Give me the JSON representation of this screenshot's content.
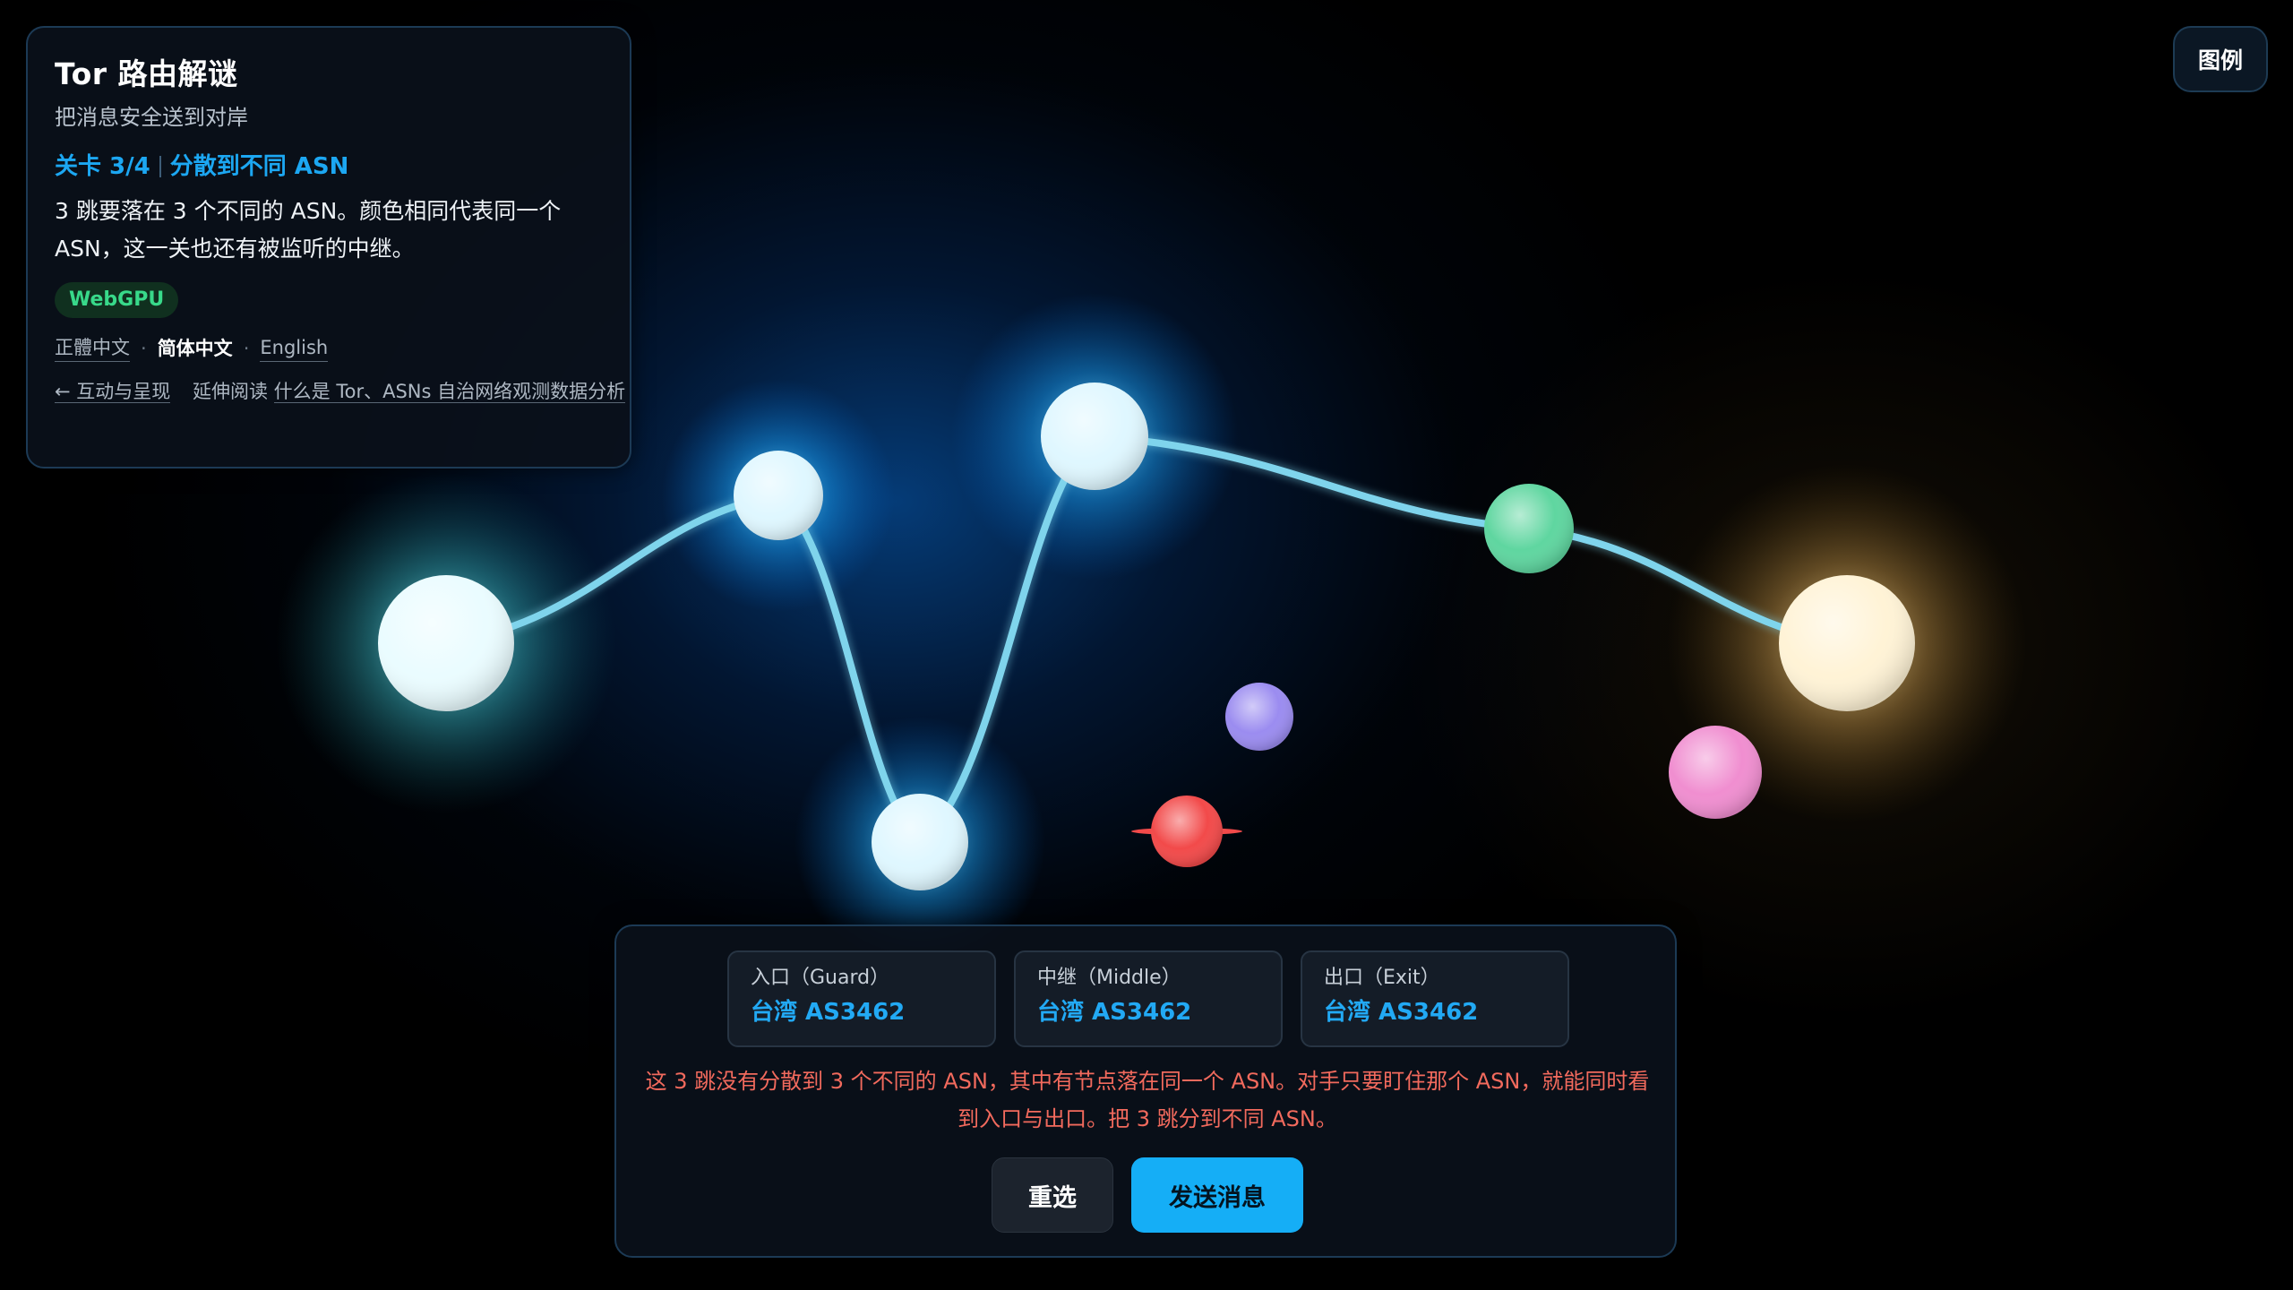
{
  "colors": {
    "accent": "#1ca7f2",
    "warning": "#f26a5d",
    "badge": "#38d98a",
    "path_line": "#7fd4ec",
    "send_button": "#15aef6"
  },
  "info": {
    "title": "Tor 路由解谜",
    "subtitle": "把消息安全送到对岸",
    "level_label": "关卡 3/4",
    "level_name": "分散到不同 ASN",
    "description": "3 跳要落在 3 个不同的 ASN。颜色相同代表同一个 ASN，这一关也还有被监听的中继。",
    "renderer_badge": "WebGPU",
    "languages": [
      "正體中文",
      "简体中文",
      "English"
    ],
    "active_language": "简体中文",
    "back_link": "← 互动与呈现",
    "further_reading_label": "延伸阅读",
    "further_reading_link": "什么是 Tor、ASNs 自治网络观测数据分析"
  },
  "legend": {
    "label": "图例"
  },
  "route": {
    "hops": [
      {
        "role": "入口（Guard）",
        "value": "台湾 AS3462"
      },
      {
        "role": "中继（Middle）",
        "value": "台湾 AS3462"
      },
      {
        "role": "出口（Exit）",
        "value": "台湾 AS3462"
      }
    ],
    "warning": "这 3 跳没有分散到 3 个不同的 ASN，其中有节点落在同一个 ASN。对手只要盯住那个 ASN，就能同时看到入口与出口。把 3 跳分到不同 ASN。",
    "reselect_label": "重选",
    "send_label": "发送消息"
  },
  "nodes": [
    {
      "id": "origin",
      "kind": "endpoint",
      "color": "#eafcff",
      "selected": true
    },
    {
      "id": "relay-a",
      "kind": "relay",
      "color": "#dff7ff",
      "selected": true
    },
    {
      "id": "relay-b",
      "kind": "relay",
      "color": "#dff7ff",
      "selected": true
    },
    {
      "id": "relay-c",
      "kind": "relay",
      "color": "#dff7ff",
      "selected": true
    },
    {
      "id": "relay-green",
      "kind": "relay",
      "color": "#5fd6a0",
      "selected": true
    },
    {
      "id": "relay-purple",
      "kind": "relay",
      "color": "#9b8cf0",
      "selected": false
    },
    {
      "id": "relay-red",
      "kind": "relay-watched",
      "color": "#f24a4a",
      "selected": false
    },
    {
      "id": "relay-pink",
      "kind": "relay",
      "color": "#f08ed0",
      "selected": false
    },
    {
      "id": "destination",
      "kind": "endpoint",
      "color": "#fff3d6",
      "selected": true
    }
  ],
  "path": [
    "origin",
    "relay-a",
    "relay-b",
    "relay-c",
    "relay-green",
    "destination"
  ]
}
